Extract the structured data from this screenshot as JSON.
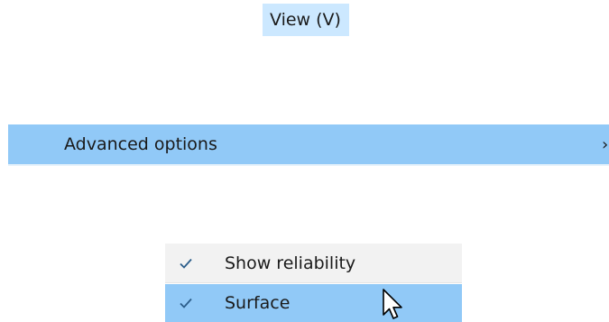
{
  "menu": {
    "title": "View (V)"
  },
  "submenu": {
    "label": "Advanced options",
    "arrow_icon": "chevron-right-icon"
  },
  "options": [
    {
      "label": "Show reliability",
      "checked": true
    },
    {
      "label": "Surface",
      "checked": true
    }
  ],
  "colors": {
    "header_highlight": "#cce8ff",
    "row_highlight": "#91c9f7",
    "menu_background": "#f2f2f2",
    "check_color": "#2b5d8a"
  },
  "cursor": "arrow-cursor-icon"
}
